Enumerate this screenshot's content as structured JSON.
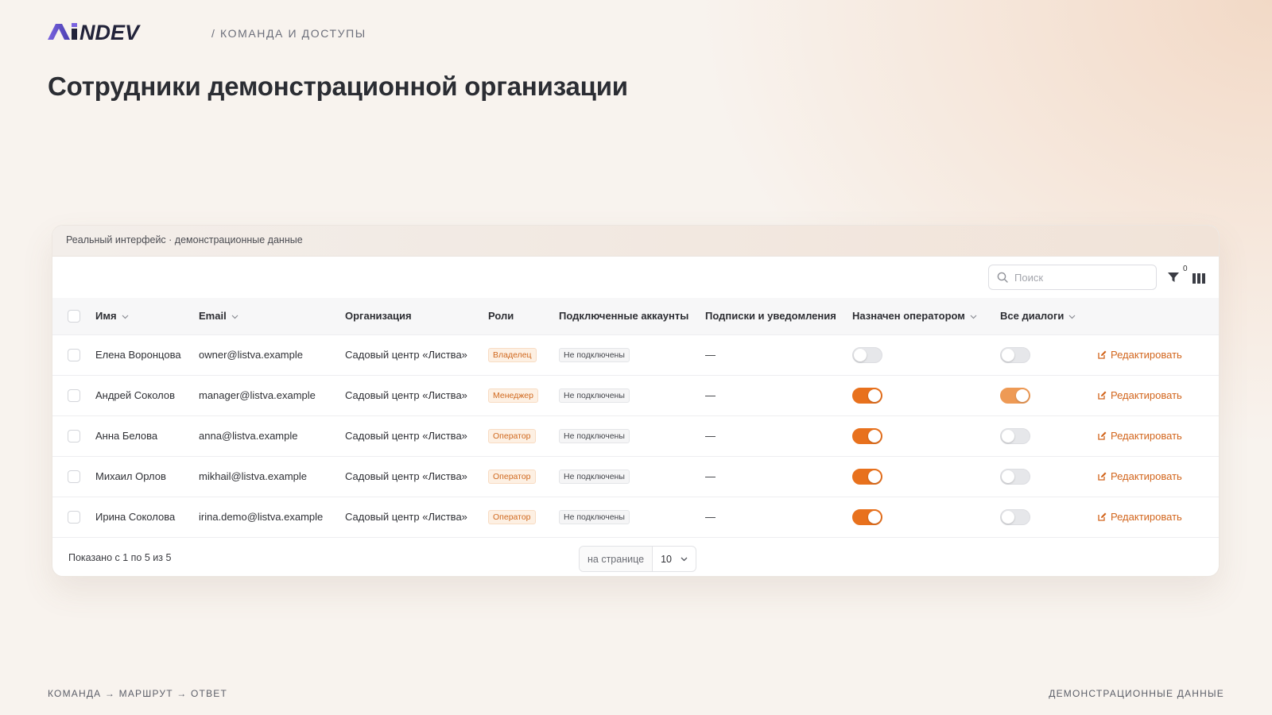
{
  "brand": {
    "logo_text": "AiNDEV",
    "breadcrumb": "/ КОМАНДА И ДОСТУПЫ"
  },
  "page_title": "Сотрудники демонстрационной организации",
  "card": {
    "header_label": "Реальный интерфейс · демонстрационные данные",
    "search_placeholder": "Поиск",
    "filter_count": "0",
    "columns": {
      "name": "Имя",
      "email": "Email",
      "org": "Организация",
      "roles": "Роли",
      "accounts": "Подключенные аккаунты",
      "subs": "Подписки и уведомления",
      "operator": "Назначен оператором",
      "all_dialogs": "Все диалоги"
    },
    "rows": [
      {
        "name": "Елена Воронцова",
        "email": "owner@listva.example",
        "org": "Садовый центр «Листва»",
        "role": "Владелец",
        "accounts": "Не подключены",
        "subs": "—",
        "operator": false,
        "all_dialogs": false,
        "edit": "Редактировать"
      },
      {
        "name": "Андрей Соколов",
        "email": "manager@listva.example",
        "org": "Садовый центр «Листва»",
        "role": "Менеджер",
        "accounts": "Не подключены",
        "subs": "—",
        "operator": true,
        "all_dialogs": true,
        "edit": "Редактировать"
      },
      {
        "name": "Анна Белова",
        "email": "anna@listva.example",
        "org": "Садовый центр «Листва»",
        "role": "Оператор",
        "accounts": "Не подключены",
        "subs": "—",
        "operator": true,
        "all_dialogs": false,
        "edit": "Редактировать"
      },
      {
        "name": "Михаил Орлов",
        "email": "mikhail@listva.example",
        "org": "Садовый центр «Листва»",
        "role": "Оператор",
        "accounts": "Не подключены",
        "subs": "—",
        "operator": true,
        "all_dialogs": false,
        "edit": "Редактировать"
      },
      {
        "name": "Ирина Соколова",
        "email": "irina.demo@listva.example",
        "org": "Садовый центр «Листва»",
        "role": "Оператор",
        "accounts": "Не подключены",
        "subs": "—",
        "operator": true,
        "all_dialogs": false,
        "edit": "Редактировать"
      }
    ],
    "footer": {
      "showing": "Показано с 1 по 5 из 5",
      "per_page_label": "на странице",
      "per_page_value": "10"
    }
  },
  "footer": {
    "left": "КОМАНДА → МАРШРУТ → ОТВЕТ",
    "right": "ДЕМОНСТРАЦИОННЫЕ ДАННЫЕ"
  },
  "colors": {
    "accent": "#e8711d",
    "logo": "#22233a",
    "logo_accent": "#6d5bd0"
  },
  "icons": [
    "search-icon",
    "filter-icon",
    "columns-icon",
    "chevron-down-icon",
    "edit-icon"
  ]
}
